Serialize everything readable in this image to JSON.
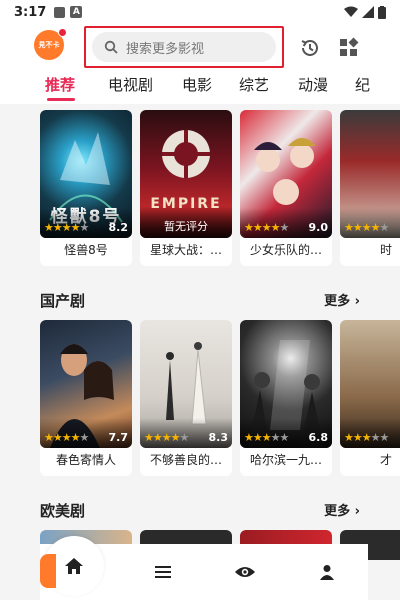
{
  "status_bar": {
    "time": "3:17",
    "badge": "A"
  },
  "header": {
    "logo_text": "見不卡",
    "search_placeholder": "搜索更多影视",
    "icons": [
      "search-icon",
      "history-icon",
      "apps-icon"
    ]
  },
  "tabs": [
    {
      "label": "推荐",
      "active": true
    },
    {
      "label": "电视剧",
      "active": false
    },
    {
      "label": "电影",
      "active": false
    },
    {
      "label": "综艺",
      "active": false
    },
    {
      "label": "动漫",
      "active": false
    },
    {
      "label": "纪",
      "active": false
    }
  ],
  "recommend": [
    {
      "title": "怪兽8号",
      "overlay": "怪獸8号",
      "score": "8.2",
      "stars": 4
    },
    {
      "title": "星球大战：…",
      "overlay": "EMPIRE",
      "score": "暂无评分",
      "stars": 0
    },
    {
      "title": "少女乐队的…",
      "overlay": "",
      "score": "9.0",
      "stars": 4
    },
    {
      "title": "时",
      "overlay": "",
      "score": "",
      "stars": 4
    }
  ],
  "sections": [
    {
      "title": "国产剧",
      "more": "更多",
      "items": [
        {
          "title": "春色寄情人",
          "score": "7.7",
          "stars": 4
        },
        {
          "title": "不够善良的…",
          "score": "8.3",
          "stars": 4
        },
        {
          "title": "哈尔滨一九…",
          "score": "6.8",
          "stars": 3
        },
        {
          "title": "才",
          "score": "",
          "stars": 4
        }
      ]
    },
    {
      "title": "欧美剧",
      "more": "更多"
    }
  ],
  "bottom_nav": [
    "home-icon",
    "list-icon",
    "eye-icon",
    "profile-icon"
  ],
  "colors": {
    "accent": "#e82a56",
    "highlight": "#e0202f",
    "brand": "#ff7a2a",
    "star": "#f5b400"
  }
}
